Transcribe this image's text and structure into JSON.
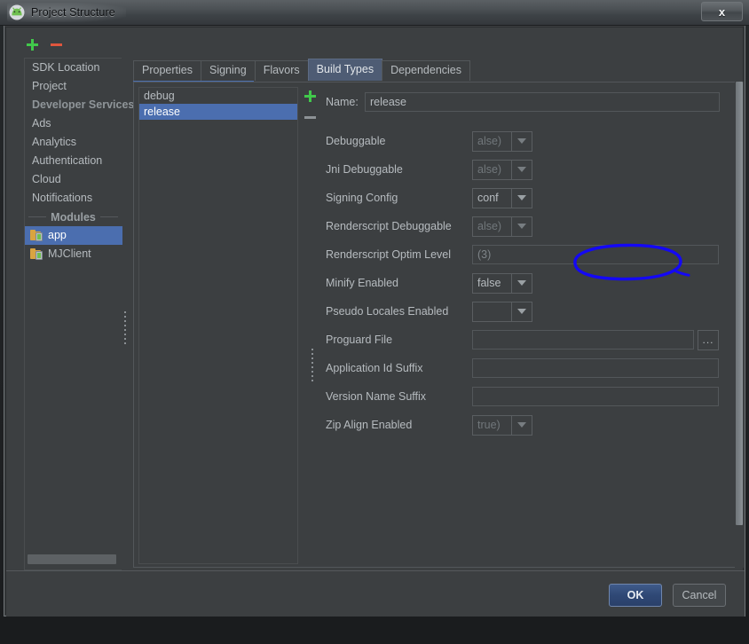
{
  "window": {
    "title": "Project Structure",
    "app_icon": "android-studio-icon",
    "close_label": "x"
  },
  "sidebar": {
    "add_icon": "plus-icon",
    "remove_icon": "minus-icon",
    "items": [
      {
        "label": "SDK Location",
        "type": "item",
        "selected": false
      },
      {
        "label": "Project",
        "type": "item",
        "selected": false
      },
      {
        "label": "Developer Services",
        "type": "header",
        "selected": false
      },
      {
        "label": "Ads",
        "type": "item",
        "selected": false
      },
      {
        "label": "Analytics",
        "type": "item",
        "selected": false
      },
      {
        "label": "Authentication",
        "type": "item",
        "selected": false
      },
      {
        "label": "Cloud",
        "type": "item",
        "selected": false
      },
      {
        "label": "Notifications",
        "type": "item",
        "selected": false
      },
      {
        "label": "Modules",
        "type": "divider",
        "selected": false
      },
      {
        "label": "app",
        "type": "module",
        "selected": true
      },
      {
        "label": "MJClient",
        "type": "module",
        "selected": false
      }
    ]
  },
  "tabs": [
    {
      "label": "Properties",
      "active": false
    },
    {
      "label": "Signing",
      "active": false
    },
    {
      "label": "Flavors",
      "active": false
    },
    {
      "label": "Build Types",
      "active": true
    },
    {
      "label": "Dependencies",
      "active": false
    }
  ],
  "build_types": {
    "add_icon": "plus-icon",
    "remove_icon": "minus-icon",
    "items": [
      {
        "label": "debug",
        "selected": false
      },
      {
        "label": "release",
        "selected": true
      }
    ]
  },
  "form": {
    "name_label": "Name:",
    "name_value": "release",
    "fields": [
      {
        "label": "Debuggable",
        "kind": "combo",
        "value": "alse)",
        "disabled": true
      },
      {
        "label": "Jni Debuggable",
        "kind": "combo",
        "value": "alse)",
        "disabled": true
      },
      {
        "label": "Signing Config",
        "kind": "combo",
        "value": "conf",
        "disabled": false
      },
      {
        "label": "Renderscript Debuggable",
        "kind": "combo",
        "value": "alse)",
        "disabled": true
      },
      {
        "label": "Renderscript Optim Level",
        "kind": "text",
        "value": "(3)",
        "disabled": true
      },
      {
        "label": "Minify Enabled",
        "kind": "combo",
        "value": "false",
        "disabled": false
      },
      {
        "label": "Pseudo Locales Enabled",
        "kind": "combo",
        "value": "",
        "disabled": false
      },
      {
        "label": "Proguard File",
        "kind": "text-browse",
        "value": "",
        "browse_label": "...",
        "disabled": false
      },
      {
        "label": "Application Id Suffix",
        "kind": "text",
        "value": "",
        "disabled": false
      },
      {
        "label": "Version Name Suffix",
        "kind": "text",
        "value": "",
        "disabled": false
      },
      {
        "label": "Zip Align Enabled",
        "kind": "combo",
        "value": "true)",
        "disabled": true
      }
    ]
  },
  "annotation": {
    "shape": "hand-drawn-ellipse",
    "color": "#1408f5",
    "target": "Signing Config"
  },
  "footer": {
    "ok_label": "OK",
    "cancel_label": "Cancel"
  },
  "colors": {
    "panel_bg": "#3c3f41",
    "selection": "#4b6eaf",
    "active_tab": "#4e5c74",
    "text": "#b6bbbf",
    "annotation": "#1408f5"
  }
}
